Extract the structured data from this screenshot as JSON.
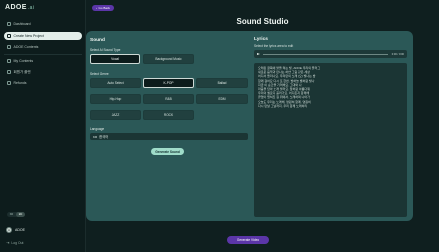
{
  "brand": {
    "logo": "ADOE",
    "logo_suffix": ".ai"
  },
  "sidebar": {
    "items": [
      {
        "label": "Dashboard"
      },
      {
        "label": "Create New Project"
      },
      {
        "label": "ADOE Contents"
      },
      {
        "label": "My Contents"
      },
      {
        "label": "회원가 플랜"
      },
      {
        "label": "Refunds"
      }
    ],
    "lang_toggle": {
      "left": "KR",
      "right": "EN"
    },
    "user": {
      "name": "ADOE",
      "avatar": "A"
    },
    "logout_label": "Log Out"
  },
  "header": {
    "back_label": "Go Back",
    "title": "Sound Studio"
  },
  "sound": {
    "heading": "Sound",
    "type_label": "Select AI Sound Type",
    "types": [
      {
        "label": "Vocal",
        "selected": true
      },
      {
        "label": "Background Music",
        "selected": false
      }
    ],
    "genre_label": "Select Genre",
    "genres": [
      {
        "label": "Auto Select",
        "selected": false
      },
      {
        "label": "K-POP",
        "selected": true
      },
      {
        "label": "Ballad",
        "selected": false
      },
      {
        "label": "Hip-Hop",
        "selected": false
      },
      {
        "label": "R&B",
        "selected": false
      },
      {
        "label": "EDM",
        "selected": false
      },
      {
        "label": "JAZZ",
        "selected": false
      },
      {
        "label": "ROCK",
        "selected": false
      }
    ],
    "language_label": "Language",
    "language_value": "한국어",
    "language_flag": "KR",
    "generate_label": "Generate Sound"
  },
  "lyrics": {
    "heading": "Lyrics",
    "subtitle": "Select the lyrics area to edit",
    "time": "0:00 / 0:00",
    "lines": [
      "오래된 골목에 불을 켜는 빛, ADOE 우리의 플러그",
      "새로운 음악과 만나는 하얀 그림 같은 세상",
      "어디서 들리나요, 우리만의 노래 (오) 빛나는 밤",
      "함께 걸어요 다시 또 한번, 밤하늘 별처럼 빛나",
      "지금 이 순간을 기억해요, 그대와 나",
      "마음을 담아 노래 불러요, 꿈처럼 아름다워",
      "우리의 멜로디 흘러가요, 어디든지 함께해",
      "끝없이 펼쳐진 길 위에서, 노래하며 나아가",
      "오늘도 우리는 노래해, 영원히 함께, 영원히",
      "다시 만날 그날까지, 우리 함께 노래하리"
    ]
  },
  "footer": {
    "generate_video_label": "Generate Video"
  }
}
